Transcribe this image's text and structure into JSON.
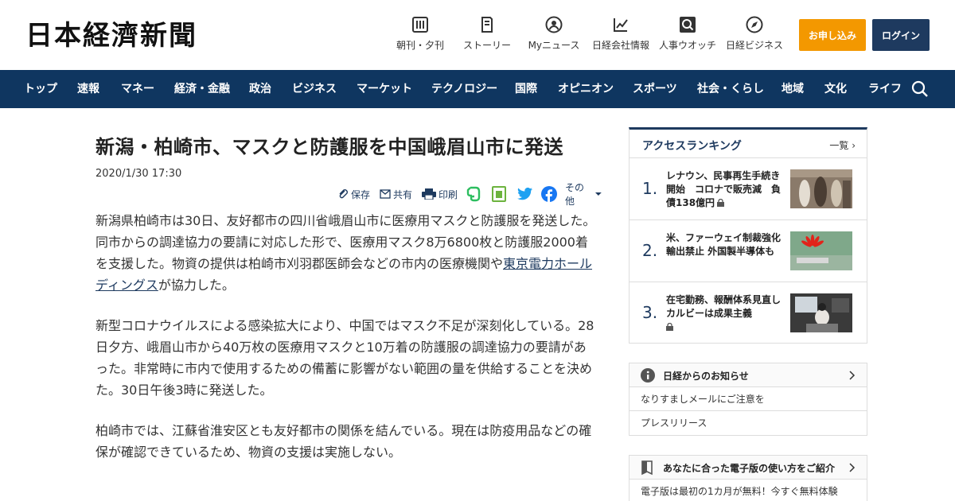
{
  "header": {
    "logo": "日本経濟新聞",
    "nav": [
      {
        "label": "朝刊・夕刊",
        "icon": "newspaper-icon"
      },
      {
        "label": "ストーリー",
        "icon": "story-icon"
      },
      {
        "label": "Myニュース",
        "icon": "user-icon"
      },
      {
        "label": "日経会社情報",
        "icon": "chart-icon"
      },
      {
        "label": "人事ウオッチ",
        "icon": "people-search-icon"
      },
      {
        "label": "日経ビジネス",
        "icon": "compass-icon"
      }
    ],
    "subscribe_label": "お申し込み",
    "login_label": "ログイン"
  },
  "navbar": {
    "items": [
      "トップ",
      "速報",
      "マネー",
      "経済・金融",
      "政治",
      "ビジネス",
      "マーケット",
      "テクノロジー",
      "国際",
      "オピニオン",
      "スポーツ",
      "社会・くらし",
      "地域",
      "文化",
      "ライフ"
    ]
  },
  "article": {
    "title": "新潟・柏崎市、マスクと防護服を中国峨眉山市に発送",
    "date": "2020/1/30 17:30",
    "tools": {
      "save": "保存",
      "share": "共有",
      "print": "印刷",
      "more": "その他"
    },
    "p1_before": "新潟県柏崎市は30日、友好都市の四川省峨眉山市に医療用マスクと防護服を発送した。同市からの調達協力の要請に対応した形で、医療用マスク8万6800枚と防護服2000着を支援した。物資の提供は柏崎市刈羽郡医師会などの市内の医療機関や",
    "p1_link": "東京電力ホールディングス",
    "p1_after": "が協力した。",
    "p2": "新型コロナウイルスによる感染拡大により、中国ではマスク不足が深刻化している。28日夕方、峨眉山市から40万枚の医療用マスクと10万着の防護服の調達協力の要請があった。非常時に市内で使用するための備蓄に影響がない範囲の量を供給することを決めた。30日午後3時に発送した。",
    "p3": "柏崎市では、江蘇省淮安区とも友好都市の関係を結んでいる。現在は防疫用品などの確保が確認できているため、物資の支援は実施しない。"
  },
  "ranking": {
    "title": "アクセスランキング",
    "more": "一覧",
    "items": [
      {
        "num": "1.",
        "text": "レナウン、民事再生手続き開始　コロナで販売減　負債138億円"
      },
      {
        "num": "2.",
        "text": "米、ファーウェイ制裁強化　輸出禁止 外国製半導体も"
      },
      {
        "num": "3.",
        "text": "在宅勤務、報酬体系見直し　カルビーは成果主義"
      }
    ]
  },
  "notice": {
    "title": "日経からのお知らせ",
    "rows": [
      "なりすましメールにご注意を",
      "プレスリリース"
    ]
  },
  "guide": {
    "title": "あなたに合った電子版の使い方をご紹介",
    "rows": [
      "電子版は最初の1カ月が無料！今すぐ無料体験"
    ]
  },
  "colors": {
    "navy": "#0f3660",
    "accent_orange": "#f39800",
    "brand_blue": "#1e3a5f"
  }
}
